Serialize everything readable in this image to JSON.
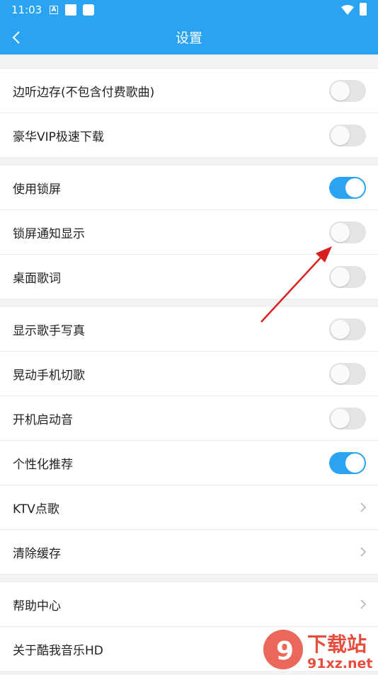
{
  "status_bar": {
    "time": "11:03",
    "icons": [
      "a-icon",
      "notification-square-icon",
      "notification-square-icon",
      "wifi-icon",
      "battery-icon"
    ]
  },
  "app_bar": {
    "title": "设置",
    "back_icon": "chevron-left-icon"
  },
  "sections": [
    {
      "rows": [
        {
          "label": "边听边存(不包含付费歌曲)",
          "control": "toggle",
          "on": false
        },
        {
          "label": "豪华VIP极速下载",
          "control": "toggle",
          "on": false
        }
      ]
    },
    {
      "rows": [
        {
          "label": "使用锁屏",
          "control": "toggle",
          "on": true
        },
        {
          "label": "锁屏通知显示",
          "control": "toggle",
          "on": false
        },
        {
          "label": "桌面歌词",
          "control": "toggle",
          "on": false
        }
      ]
    },
    {
      "rows": [
        {
          "label": "显示歌手写真",
          "control": "toggle",
          "on": false
        },
        {
          "label": "晃动手机切歌",
          "control": "toggle",
          "on": false
        },
        {
          "label": "开机启动音",
          "control": "toggle",
          "on": false
        },
        {
          "label": "个性化推荐",
          "control": "toggle",
          "on": true
        },
        {
          "label": "KTV点歌",
          "control": "chevron"
        },
        {
          "label": "清除缓存",
          "control": "chevron"
        }
      ]
    },
    {
      "rows": [
        {
          "label": "帮助中心",
          "control": "chevron"
        },
        {
          "label": "关于酷我音乐HD",
          "control": "none"
        }
      ]
    }
  ],
  "watermark": {
    "logo": "9",
    "brand": "下载站",
    "site": "91xz.net"
  },
  "colors": {
    "accent": "#29a3f2",
    "toggle_off": "#e4e4e4",
    "background": "#f2f2f2",
    "annotation_arrow": "#d92020"
  }
}
